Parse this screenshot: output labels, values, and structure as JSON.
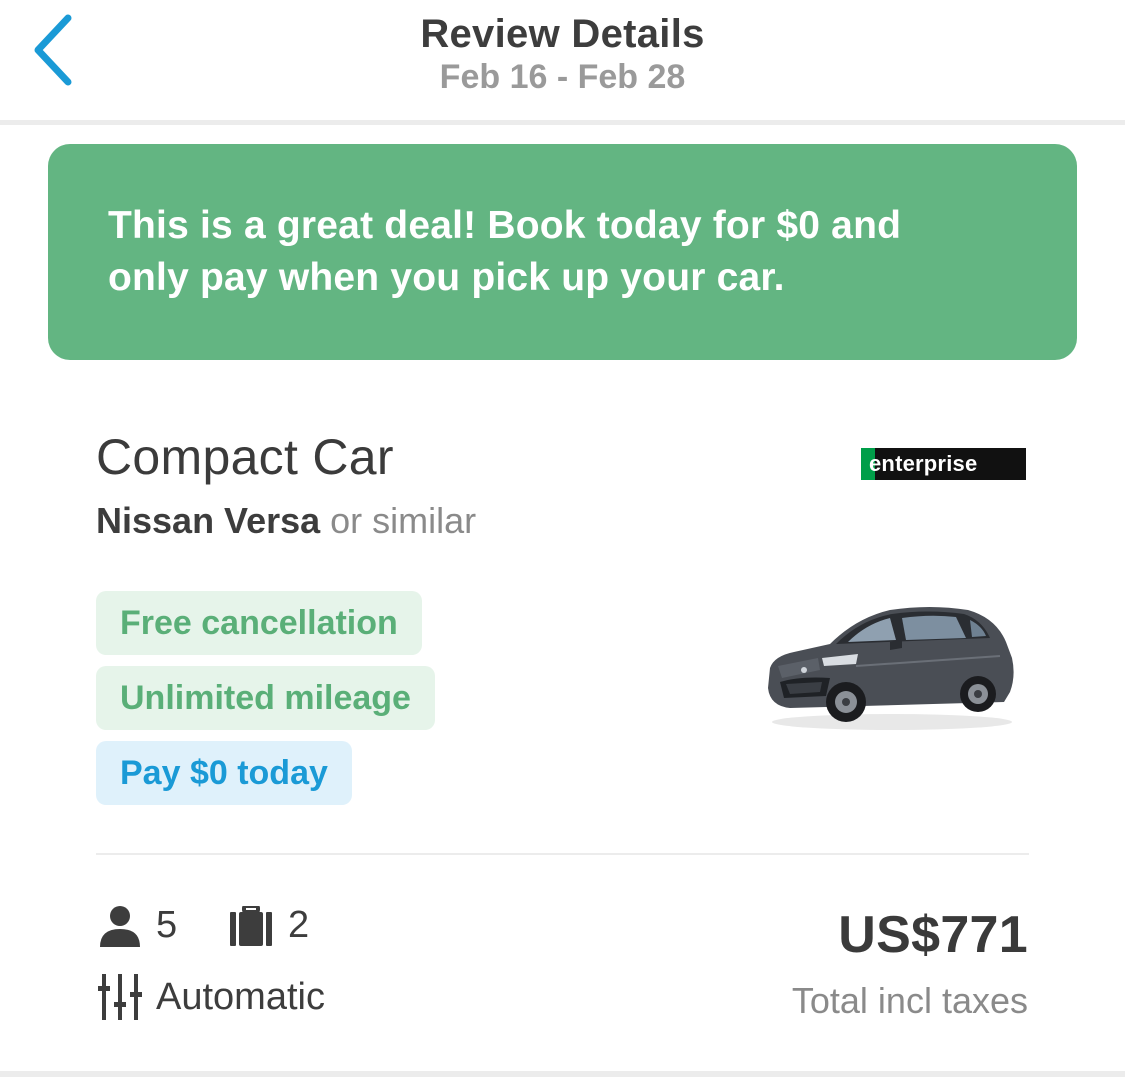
{
  "header": {
    "title": "Review Details",
    "dates": "Feb 16 - Feb 28",
    "back_icon": "chevron-left-icon"
  },
  "banner": {
    "line1": "This is a great deal! Book today for $0 and",
    "line2": "only pay when you pick up your car."
  },
  "car": {
    "category": "Compact Car",
    "model": "Nissan Versa",
    "similar": " or similar",
    "brand_logo_text": "enterprise",
    "badges": [
      {
        "label": "Free cancellation",
        "style": "green"
      },
      {
        "label": "Unlimited mileage",
        "style": "green"
      },
      {
        "label": "Pay $0 today",
        "style": "blue"
      }
    ],
    "image": "car-photo"
  },
  "specs": {
    "seats": "5",
    "seats_icon": "person-icon",
    "bags": "2",
    "bags_icon": "luggage-icon",
    "transmission": "Automatic",
    "transmission_icon": "sliders-icon"
  },
  "price": {
    "amount": "US$771",
    "note": "Total incl taxes"
  },
  "colors": {
    "accent_blue": "#1a9ad6",
    "banner_green": "#63b582",
    "badge_green_text": "#5aaf78",
    "badge_green_bg": "#e6f4ea",
    "badge_blue_bg": "#dff1fb"
  }
}
